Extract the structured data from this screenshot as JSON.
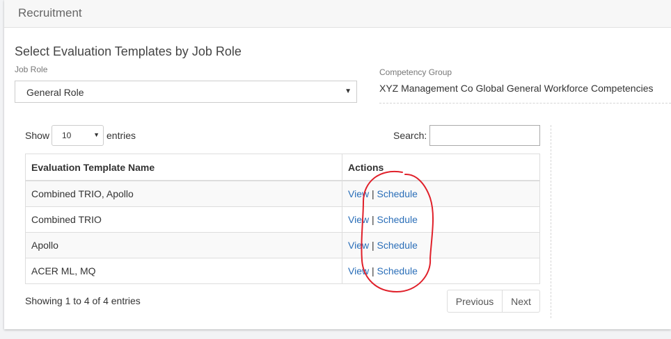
{
  "header": {
    "title": "Recruitment"
  },
  "form": {
    "section_title": "Select Evaluation Templates by Job Role",
    "job_role_label": "Job Role",
    "job_role_value": "General Role",
    "competency_label": "Competency Group",
    "competency_value": "XYZ Management Co Global General Workforce Competencies"
  },
  "table_controls": {
    "show_label": "Show",
    "entries_value": "10",
    "entries_label": "entries",
    "search_label": "Search:",
    "search_value": ""
  },
  "table": {
    "columns": [
      "Evaluation Template Name",
      "Actions"
    ],
    "rows": [
      {
        "name": "Combined TRIO, Apollo",
        "view": "View",
        "sep": "|",
        "schedule": "Schedule"
      },
      {
        "name": "Combined TRIO",
        "view": "View",
        "sep": "|",
        "schedule": "Schedule"
      },
      {
        "name": "Apollo",
        "view": "View",
        "sep": "|",
        "schedule": "Schedule"
      },
      {
        "name": "ACER ML, MQ",
        "view": "View",
        "sep": "|",
        "schedule": "Schedule"
      }
    ]
  },
  "footer": {
    "info": "Showing 1 to 4 of 4 entries",
    "previous_label": "Previous",
    "next_label": "Next"
  },
  "colors": {
    "link": "#2a6eb8",
    "annotation": "#e0202a"
  }
}
